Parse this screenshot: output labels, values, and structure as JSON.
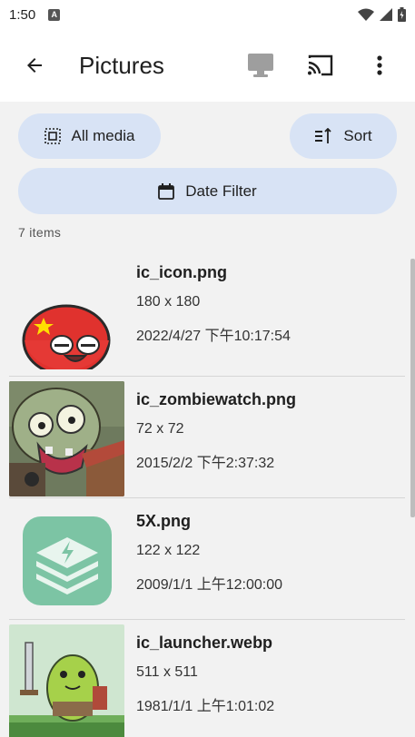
{
  "status_bar": {
    "time": "1:50",
    "notif_letter": "A"
  },
  "app_bar": {
    "title": "Pictures",
    "icons": [
      "back-arrow-icon",
      "monitor-icon",
      "cast-icon",
      "more-vert-icon"
    ]
  },
  "filters": {
    "all_media_label": "All media",
    "sort_label": "Sort",
    "date_filter_label": "Date Filter"
  },
  "item_count": "7 items",
  "items": [
    {
      "name": "ic_icon.png",
      "dims": "180 x 180",
      "date": "2022/4/27 下午10:17:54",
      "thumb": "red-ball-character"
    },
    {
      "name": "ic_zombiewatch.png",
      "dims": "72 x 72",
      "date": "2015/2/2 下午2:37:32",
      "thumb": "zombie"
    },
    {
      "name": "5X.png",
      "dims": "122 x 122",
      "date": "2009/1/1 上午12:00:00",
      "thumb": "layers-bolt-icon"
    },
    {
      "name": "ic_launcher.webp",
      "dims": "511 x 511",
      "date": "1981/1/1 上午1:01:02",
      "thumb": "green-knight-character"
    }
  ],
  "colors": {
    "chip": "#d8e3f5",
    "accent_green": "#7cc4a4",
    "background": "#f2f2f2"
  }
}
